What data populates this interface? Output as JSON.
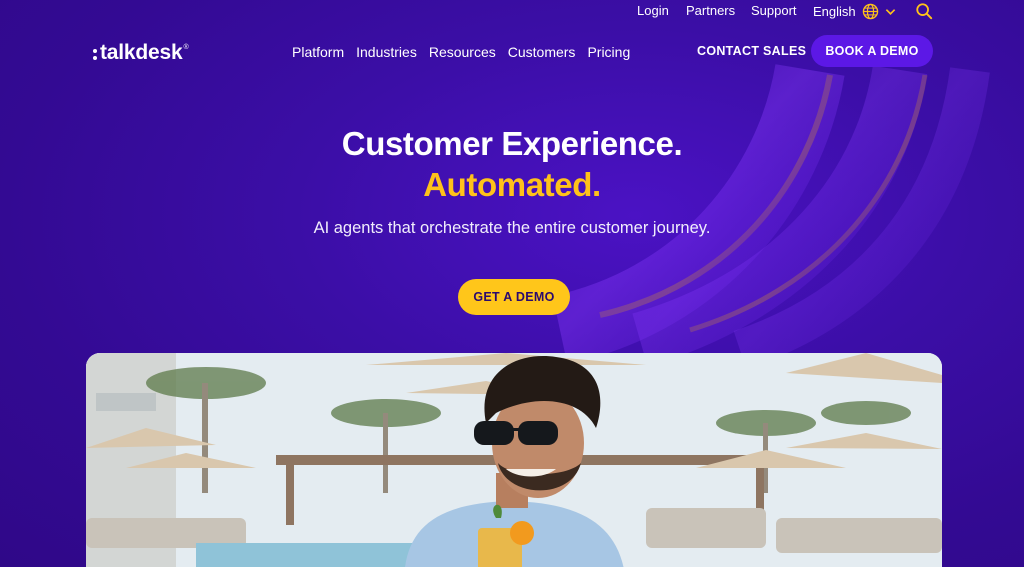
{
  "utility_nav": {
    "login": "Login",
    "partners": "Partners",
    "support": "Support",
    "language": "English",
    "icons": {
      "globe": "globe-icon",
      "chevron": "chevron-down-icon",
      "search": "search-icon"
    }
  },
  "brand": {
    "name": "talkdesk",
    "mark": "®"
  },
  "main_nav": [
    "Platform",
    "Industries",
    "Resources",
    "Customers",
    "Pricing"
  ],
  "header_actions": {
    "contact": "CONTACT SALES",
    "book": "BOOK A DEMO"
  },
  "hero": {
    "title": "Customer Experience.",
    "accent": "Automated.",
    "subtitle": "AI agents that orchestrate the entire customer journey.",
    "cta": "GET A DEMO"
  },
  "colors": {
    "background": "#3b0ea6",
    "accent_yellow": "#ffc21a",
    "primary_button": "#5c18e6"
  }
}
